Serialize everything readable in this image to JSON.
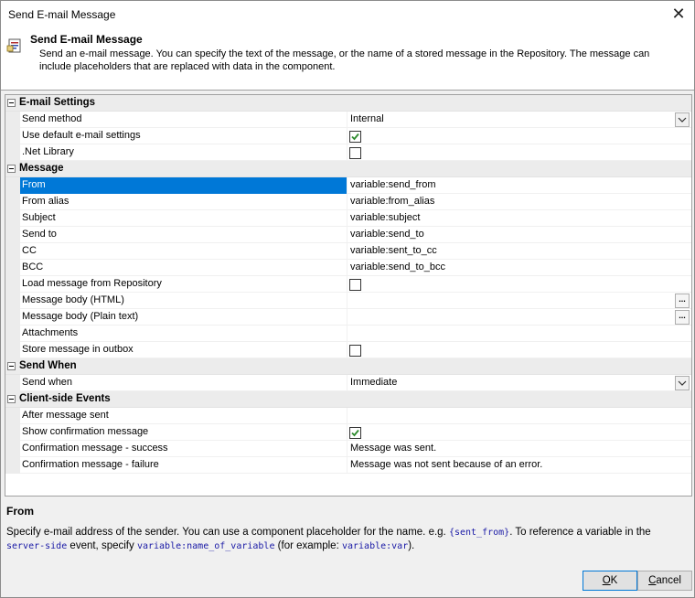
{
  "window": {
    "title": "Send E-mail Message"
  },
  "header": {
    "title": "Send E-mail Message",
    "description": "Send an e-mail message. You can specify the text of the message, or the name of a stored message in the Repository. The message can include placeholders that are replaced with data in the component."
  },
  "grid": {
    "email_settings": {
      "label": "E-mail Settings",
      "send_method": {
        "name": "Send method",
        "value": "Internal"
      },
      "use_default": {
        "name": "Use default e-mail settings",
        "checked": true
      },
      "net_library": {
        "name": ".Net Library",
        "checked": false
      }
    },
    "message": {
      "label": "Message",
      "from": {
        "name": "From",
        "value": "variable:send_from"
      },
      "from_alias": {
        "name": "From alias",
        "value": "variable:from_alias"
      },
      "subject": {
        "name": "Subject",
        "value": "variable:subject"
      },
      "send_to": {
        "name": "Send to",
        "value": "variable:send_to"
      },
      "cc": {
        "name": "CC",
        "value": "variable:sent_to_cc"
      },
      "bcc": {
        "name": "BCC",
        "value": "variable:send_to_bcc"
      },
      "load_from_repo": {
        "name": "Load message from Repository",
        "checked": false
      },
      "body_html": {
        "name": "Message body (HTML)",
        "button": "..."
      },
      "body_plain": {
        "name": "Message body (Plain text)",
        "button": "..."
      },
      "attachments": {
        "name": "Attachments"
      },
      "store_outbox": {
        "name": "Store message in outbox",
        "checked": false
      }
    },
    "send_when": {
      "label": "Send When",
      "send_when": {
        "name": "Send when",
        "value": "Immediate"
      }
    },
    "client_events": {
      "label": "Client-side Events",
      "after_sent": {
        "name": "After message sent"
      },
      "show_confirm": {
        "name": "Show confirmation message",
        "checked": true
      },
      "confirm_success": {
        "name": "Confirmation message - success",
        "value": "Message was sent."
      },
      "confirm_failure": {
        "name": "Confirmation message - failure",
        "value": "Message was not sent because of an error."
      }
    }
  },
  "help": {
    "title": "From",
    "text1": "Specify e-mail address of the sender. You can use a component placeholder for the name. e.g. ",
    "code1": "{sent_from}",
    "text2": ". To reference a variable in the ",
    "code2": "server-side",
    "text3": " event, specify ",
    "code3": "variable:name_of_variable",
    "text4": " (for example: ",
    "code4": "variable:var",
    "text5": ")."
  },
  "buttons": {
    "ok_hotkey": "O",
    "ok_rest": "K",
    "cancel_hotkey": "C",
    "cancel_rest": "ancel"
  },
  "colors": {
    "selection": "#0078d7",
    "code": "#1a1aa6",
    "check": "#2e8b2e"
  },
  "icons": {
    "close": "close-icon",
    "email": "email-message-icon",
    "checkmark": "checkmark-icon"
  }
}
